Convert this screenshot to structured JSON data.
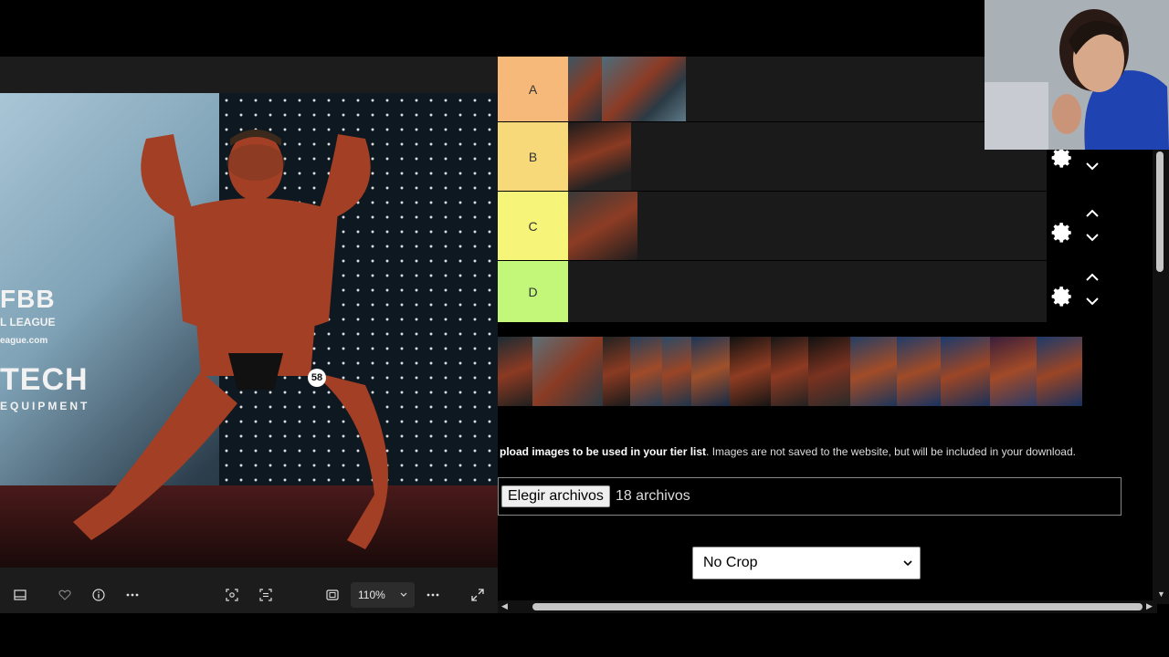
{
  "viewer": {
    "photo": {
      "logo_line1": "FBB",
      "logo_line2": "L LEAGUE",
      "logo_line3": "eague.com",
      "logo_line4": "TECH",
      "logo_line5": "EQUIPMENT",
      "bib_number": "58"
    },
    "toolbar": {
      "filmstrip_icon": "filmstrip-icon",
      "favorite_icon": "heart-icon",
      "info_icon": "info-icon",
      "more_icon": "more-icon",
      "visual_search_icon": "visual-search-icon",
      "text_scan_icon": "text-scan-icon",
      "fit_icon": "fit-screen-icon",
      "zoom_value": "110%",
      "expand_icon": "expand-icon"
    }
  },
  "tiers": [
    {
      "label": "A",
      "color": "#f7b97a"
    },
    {
      "label": "B",
      "color": "#f7d97a"
    },
    {
      "label": "C",
      "color": "#f7f47a"
    },
    {
      "label": "D",
      "color": "#c3f77a"
    }
  ],
  "upload": {
    "prefix_bold": "pload images to be used in your tier list",
    "rest": ". Images are not saved to the website, but will be included in your download.",
    "button_label": "Elegir archivos",
    "file_count": "18 archivos"
  },
  "crop_select": {
    "selected": "No Crop"
  }
}
